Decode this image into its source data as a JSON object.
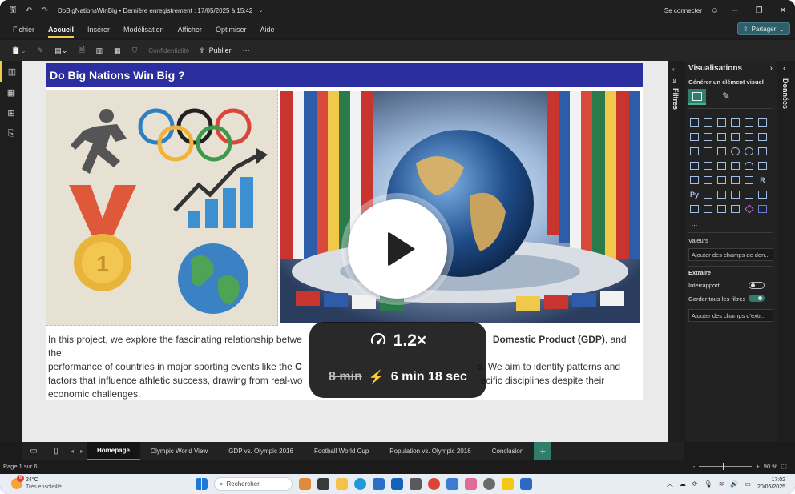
{
  "window": {
    "doc_title": "DoBigNationsWinBig • Dernière enregistrement : 17/05/2025 à 15:42",
    "sign_in": "Se connecter"
  },
  "menu": {
    "items": [
      "Fichier",
      "Accueil",
      "Insérer",
      "Modélisation",
      "Afficher",
      "Optimiser",
      "Aide"
    ],
    "share_label": "Partager"
  },
  "ribbon": {
    "confidentiality": "Confidentialité",
    "publish": "Publier",
    "more": "···"
  },
  "report": {
    "title": "Do Big Nations Win Big ?",
    "desc_1": "In this project, we explore the fascinating relationship betwe",
    "desc_2": "Domestic Product (GDP)",
    "desc_3": ", and the",
    "desc_4": "performance of countries in major sporting events like the ",
    "desc_5": "C",
    "desc_6": "o",
    "desc_7": ". We aim to identify patterns and",
    "desc_8": "factors that influence athletic success, drawing from real-wo",
    "desc_9": "ecific disciplines despite their",
    "desc_10": "economic challenges."
  },
  "pages": {
    "tabs": [
      "Homepage",
      "Olympic World View",
      "GDP vs. Olympic 2016",
      "Football World Cup",
      "Population vs. Olympic 2016",
      "Conclusion"
    ],
    "add": "+"
  },
  "status": {
    "page": "Page 1 sur 6",
    "zoom_minus": "-",
    "zoom_plus": "+",
    "zoom": "90 %"
  },
  "filters": {
    "label": "Filtres"
  },
  "visualizations": {
    "title": "Visualisations",
    "build": "Générer un élément visuel",
    "values_label": "Valeurs",
    "values_field": "Ajouter des champs de don...",
    "extract_label": "Extraire",
    "cross_report": "Interrapport",
    "keep_filters": "Garder tous les filtres",
    "drill_field": "Ajouter des champs d'extr...",
    "more": "...",
    "r_label": "R",
    "py_label": "Py"
  },
  "data_pane": {
    "label": "Données"
  },
  "taskbar": {
    "temp": "24°C",
    "weather": "Très ensoleillé",
    "search": "Rechercher",
    "time": "17:02",
    "date": "20/05/2025",
    "badge": "6"
  },
  "player": {
    "speed": "1.2×",
    "old_time": "8 min",
    "new_time": "6 min 18 sec"
  }
}
